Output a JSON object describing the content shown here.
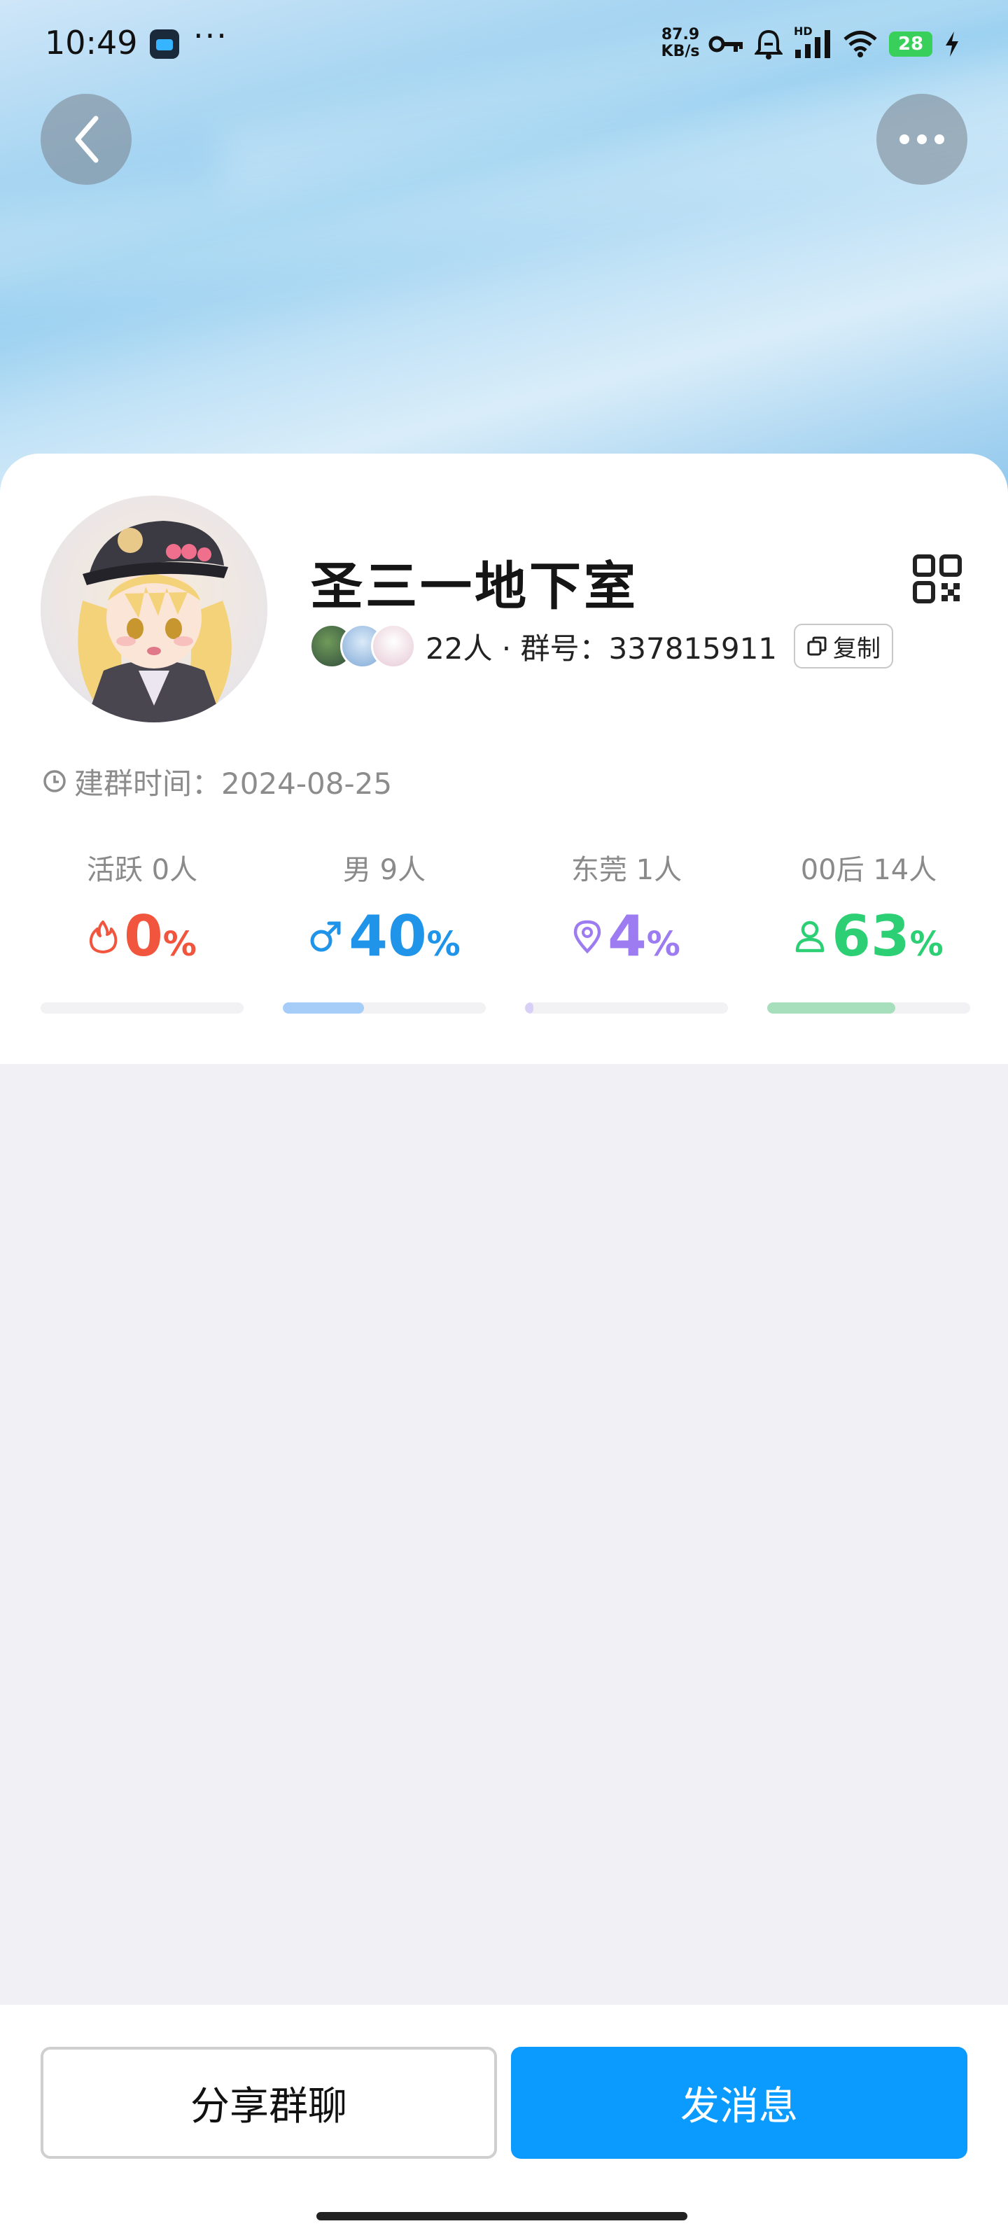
{
  "status_bar": {
    "time": "10:49",
    "more": "···",
    "net_speed_value": "87.9",
    "net_speed_unit": "KB/s",
    "signal_tag": "HD",
    "battery": "28"
  },
  "header": {
    "back_icon": "chevron-left-icon",
    "more_icon": "more-horizontal-icon"
  },
  "group": {
    "name": "圣三一地下室",
    "member_count": "22人",
    "separator": " · ",
    "number_label": "群号：",
    "number": "337815911",
    "copy_label": "复制",
    "created_label": "建群时间：",
    "created_date": "2024-08-25"
  },
  "stats": [
    {
      "label": "活跃 0人",
      "value": "0",
      "unit": "%",
      "percent": 0,
      "color": "#f2553d",
      "icon": "flame-icon"
    },
    {
      "label": "男 9人",
      "value": "40",
      "unit": "%",
      "percent": 40,
      "color": "#1f94e8",
      "icon": "male-icon"
    },
    {
      "label": "东莞 1人",
      "value": "4",
      "unit": "%",
      "percent": 4,
      "color": "#9c7cf0",
      "icon": "location-pin-icon"
    },
    {
      "label": "00后 14人",
      "value": "63",
      "unit": "%",
      "percent": 63,
      "color": "#2dcf74",
      "icon": "person-icon"
    }
  ],
  "stat_bar_colors": [
    "#f6c9c0",
    "#a6cdf7",
    "#d9d0f8",
    "#a7dfbd"
  ],
  "actions": {
    "share_label": "分享群聊",
    "send_label": "发消息"
  },
  "colors": {
    "primary": "#0b9bff"
  }
}
